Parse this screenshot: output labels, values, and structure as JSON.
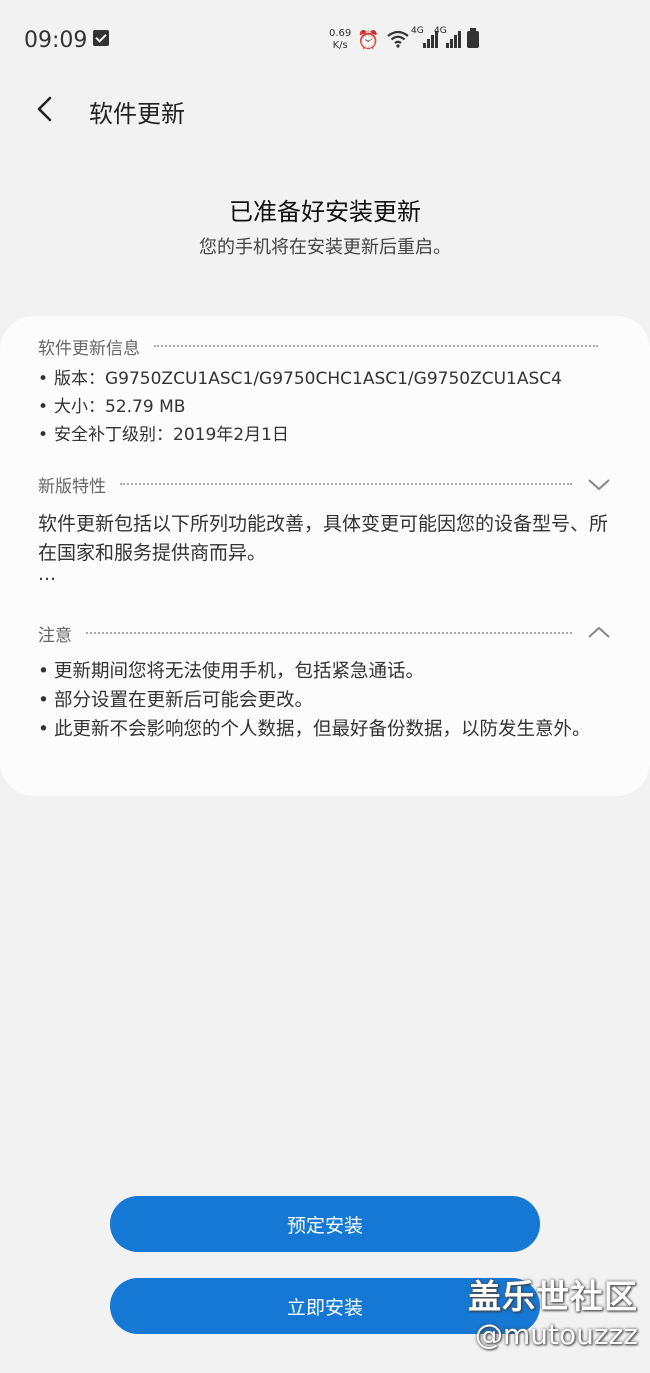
{
  "status_bar": {
    "time": "09:09",
    "speed_value": "0.69",
    "speed_unit": "K/s",
    "signal1_label": "4G",
    "signal2_label": "4G"
  },
  "header": {
    "title": "软件更新",
    "back_icon": "chevron-left-icon"
  },
  "hero": {
    "title": "已准备好安装更新",
    "subtitle": "您的手机将在安装更新后重启。"
  },
  "update_info": {
    "heading": "软件更新信息",
    "items": [
      "版本：G9750ZCU1ASC1/G9750CHC1ASC1/G9750ZCU1ASC4",
      "大小：52.79 MB",
      "安全补丁级别：2019年2月1日"
    ]
  },
  "features": {
    "heading": "新版特性",
    "text": "软件更新包括以下所列功能改善，具体变更可能因您的设备型号、所在国家和服务提供商而异。",
    "more": "…",
    "toggle_icon": "chevron-down-icon"
  },
  "notes": {
    "heading": "注意",
    "toggle_icon": "chevron-up-icon",
    "items": [
      "更新期间您将无法使用手机，包括紧急通话。",
      "部分设置在更新后可能会更改。",
      "此更新不会影响您的个人数据，但最好备份数据，以防发生意外。"
    ]
  },
  "actions": {
    "schedule_label": "预定安装",
    "install_now_label": "立即安装"
  },
  "watermark": {
    "line1": "盖乐世社区",
    "line2": "@mutouzzz"
  },
  "colors": {
    "accent": "#1478d4",
    "background": "#f2f2f2",
    "card": "#fcfcfc"
  }
}
